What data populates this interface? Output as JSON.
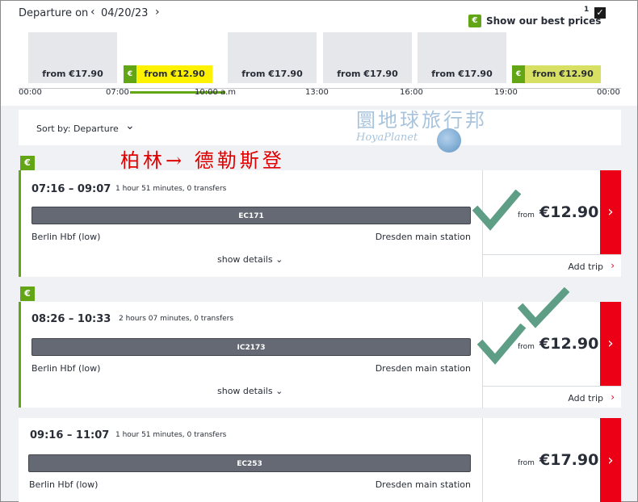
{
  "header": {
    "departure_label": "Departure on",
    "date": "04/20/23",
    "prev_chevron": "‹",
    "next_chevron": "›",
    "best_prices_label": "Show our best prices",
    "best_prices_footnote": "1",
    "best_prices_checked": "✓",
    "euro_badge": "€"
  },
  "timeline": {
    "slots": [
      {
        "price": "from €17.90",
        "best": false
      },
      {
        "price": "from €12.90",
        "best": true
      },
      {
        "price": "from €17.90",
        "best": false
      },
      {
        "price": "from €17.90",
        "best": false
      },
      {
        "price": "from €17.90",
        "best": false
      },
      {
        "price": "from €12.90",
        "best": true
      }
    ],
    "ticks": [
      "00:00",
      "07:00",
      "10:00 a.m",
      "13:00",
      "16:00",
      "19:00",
      "00:00"
    ]
  },
  "sort": {
    "label": "Sort by: Departure",
    "chevron": "⌄"
  },
  "watermark": {
    "chinese": "圜地球旅行邦",
    "english": "HoyaPlanet"
  },
  "overlay_route": "柏林→ 德勒斯登",
  "connections": [
    {
      "best": true,
      "euro_badge": "€",
      "times": "07:16 – 09:07",
      "meta": "1 hour 51 minutes, 0 transfers",
      "train": "EC171",
      "from_station": "Berlin Hbf (low)",
      "to_station": "Dresden main station",
      "details_label": "show details ⌄",
      "price_from": "from",
      "price": "€12.90",
      "add_trip": "Add trip",
      "add_trip_chevron": "›",
      "arrow": "›"
    },
    {
      "best": true,
      "euro_badge": "€",
      "times": "08:26 – 10:33",
      "meta": "2 hours 07 minutes, 0 transfers",
      "train": "IC2173",
      "from_station": "Berlin Hbf (low)",
      "to_station": "Dresden main station",
      "details_label": "show details ⌄",
      "price_from": "from",
      "price": "€12.90",
      "add_trip": "Add trip",
      "add_trip_chevron": "›",
      "arrow": "›"
    },
    {
      "best": false,
      "times": "09:16 – 11:07",
      "meta": "1 hour 51 minutes, 0 transfers",
      "train": "EC253",
      "from_station": "Berlin Hbf (low)",
      "to_station": "Dresden main station",
      "price_from": "from",
      "price": "€17.90",
      "arrow": "›"
    }
  ],
  "colors": {
    "accent_green": "#63a615",
    "best_yellow": "#fff200",
    "db_red": "#ec0016",
    "check_mark": "#5e9e86"
  }
}
